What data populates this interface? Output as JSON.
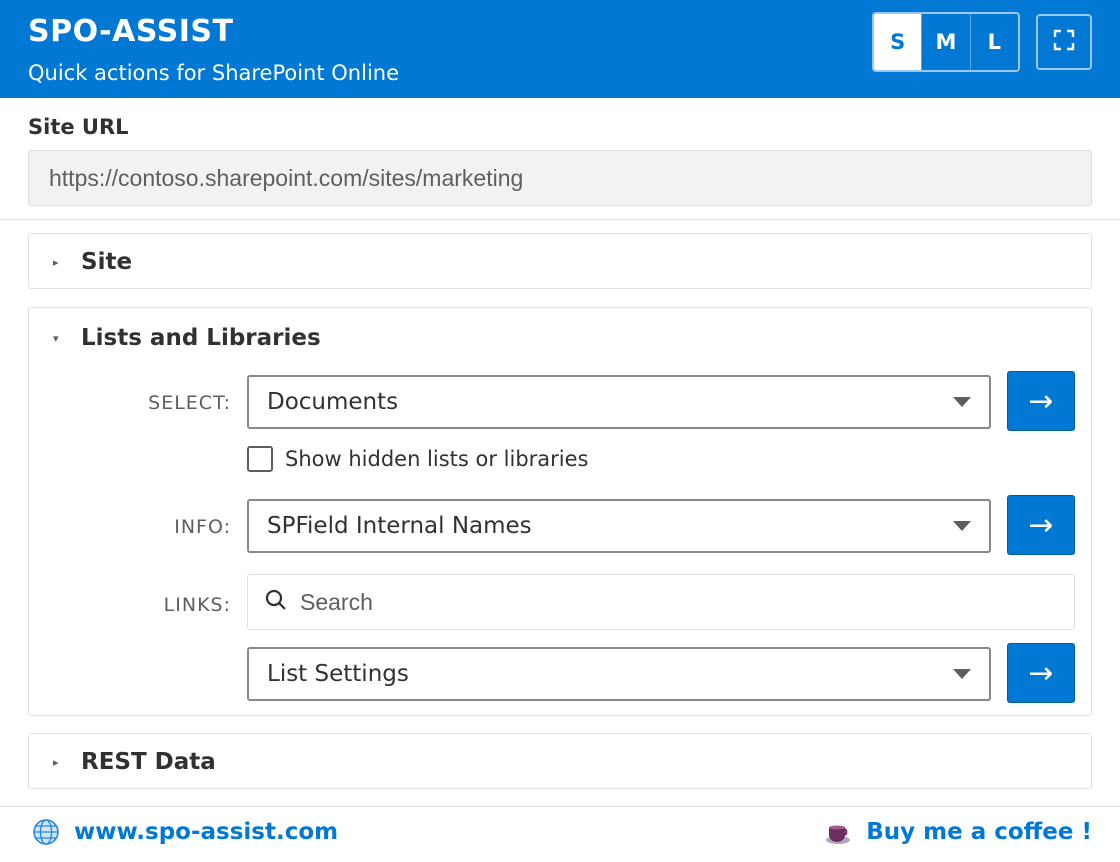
{
  "header": {
    "title": "SPO-ASSIST",
    "subtitle": "Quick actions for SharePoint Online",
    "size_options": [
      "S",
      "M",
      "L"
    ],
    "selected_size": "S",
    "brand_color": "#0078d4"
  },
  "site_url": {
    "label": "Site URL",
    "value": "https://contoso.sharepoint.com/sites/marketing"
  },
  "sections": {
    "site": {
      "title": "Site",
      "expanded": false
    },
    "lists": {
      "title": "Lists and Libraries",
      "expanded": true,
      "select_label": "SELECT:",
      "select_value": "Documents",
      "show_hidden_label": "Show hidden lists or libraries",
      "show_hidden_checked": false,
      "info_label": "INFO:",
      "info_value": "SPField Internal Names",
      "links_label": "LINKS:",
      "search_placeholder": "Search",
      "links_value": "List Settings",
      "go_symbol": "→"
    },
    "rest": {
      "title": "REST Data",
      "expanded": false
    }
  },
  "footer": {
    "website_link": "www.spo-assist.com",
    "coffee_link": "Buy me a coffee !"
  }
}
